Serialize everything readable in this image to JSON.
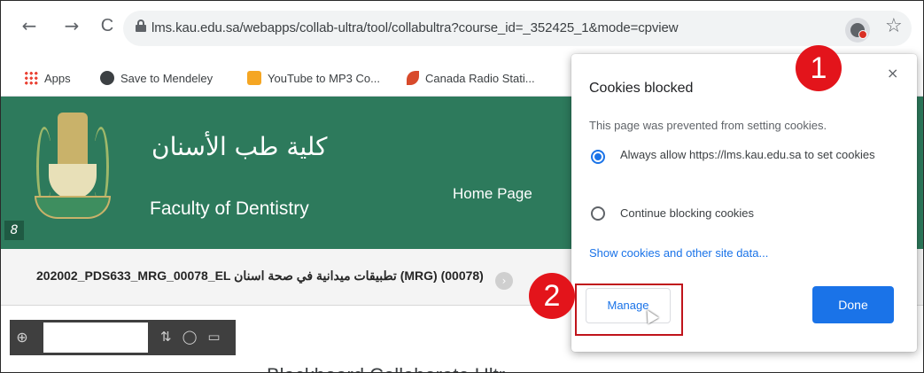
{
  "browser": {
    "nav": {
      "back_icon": "←",
      "forward_icon": "→",
      "reload_icon": "C"
    },
    "url": "lms.kau.edu.sa/webapps/collab-ultra/tool/collabultra?course_id=_352425_1&mode=cpview",
    "star_icon": "☆"
  },
  "bookmarks": [
    {
      "label": "Apps",
      "icon": "apps-grid-icon"
    },
    {
      "label": "Save to Mendeley",
      "icon": "globe-icon"
    },
    {
      "label": "YouTube to MP3 Co...",
      "icon": "bookmark-icon"
    },
    {
      "label": "Canada Radio Stati...",
      "icon": "leaf-icon"
    }
  ],
  "site": {
    "name_ar": "كلية طب الأسنان",
    "name_en": "Faculty of Dentistry",
    "home_link": "Home Page",
    "edit_icon": "8"
  },
  "course": {
    "title": "202002_PDS633_MRG_00078_EL تطبيقات ميدانية في صحة اسنان (MRG) (00078)",
    "chevron": "›"
  },
  "collab": {
    "add_icon": "⊕",
    "tool_icons": "⇅◯▭",
    "partial_heading": "Blackboard Collaborate Ultr"
  },
  "cookie_popup": {
    "title": "Cookies blocked",
    "close": "×",
    "description": "This page was prevented from setting cookies.",
    "options": [
      {
        "label": "Always allow https://lms.kau.edu.sa to set cookies",
        "selected": true
      },
      {
        "label": "Continue blocking cookies",
        "selected": false
      }
    ],
    "link": "Show cookies and other site data...",
    "manage_button": "Manage",
    "done_button": "Done"
  },
  "annotations": {
    "step1": "1",
    "step2": "2"
  },
  "colors": {
    "header_green": "#2d7a5c",
    "callout_red": "#e3141b",
    "accent_blue": "#1a73e8"
  }
}
